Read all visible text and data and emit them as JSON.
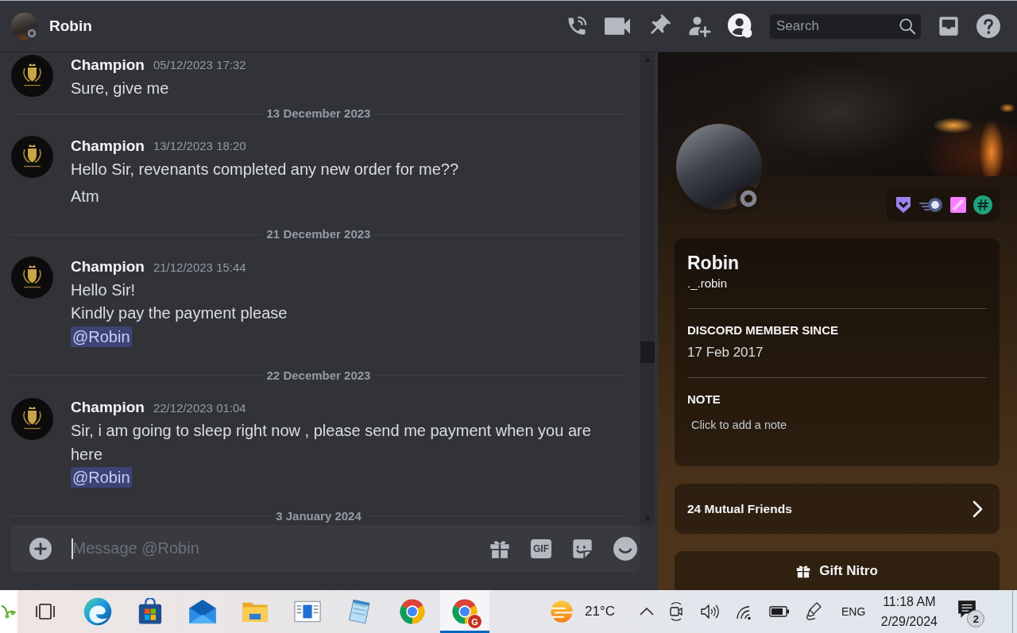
{
  "header": {
    "title": "Robin",
    "online": false,
    "profile_panel_open": true,
    "search_placeholder": "Search"
  },
  "chat": {
    "timeline": [
      {
        "kind": "group",
        "author": "Champion",
        "timestamp": "05/12/2023 17:32",
        "messages": [
          {
            "lines": [
              {
                "kind": "text",
                "text": "Sure, give me"
              }
            ]
          }
        ]
      },
      {
        "kind": "divider",
        "label": "13 December 2023"
      },
      {
        "kind": "group",
        "author": "Champion",
        "timestamp": "13/12/2023 18:20",
        "messages": [
          {
            "lines": [
              {
                "kind": "text",
                "text": "Hello Sir, revenants completed any new order for me??"
              }
            ]
          },
          {
            "lines": [
              {
                "kind": "text",
                "text": "Atm"
              }
            ]
          }
        ]
      },
      {
        "kind": "divider",
        "label": "21 December 2023"
      },
      {
        "kind": "group",
        "author": "Champion",
        "timestamp": "21/12/2023 15:44",
        "messages": [
          {
            "lines": [
              {
                "kind": "text",
                "text": "Hello Sir!"
              },
              {
                "kind": "text",
                "text": "Kindly pay the payment please"
              },
              {
                "kind": "mention",
                "text": "@Robin"
              }
            ]
          }
        ]
      },
      {
        "kind": "divider",
        "label": "22 December 2023"
      },
      {
        "kind": "group",
        "author": "Champion",
        "timestamp": "22/12/2023 01:04",
        "messages": [
          {
            "lines": [
              {
                "kind": "text",
                "text": "Sir, i am going to sleep right now , please send me payment when you are here"
              },
              {
                "kind": "mention",
                "text": "@Robin"
              }
            ]
          }
        ]
      },
      {
        "kind": "divider",
        "label": "3 January 2024"
      }
    ],
    "composer": {
      "placeholder": "Message @Robin",
      "focused": true,
      "gif_label": "GIF"
    }
  },
  "profile": {
    "display_name": "Robin",
    "username": "._.robin",
    "online": false,
    "sections": [
      {
        "heading": "DISCORD MEMBER SINCE",
        "value": "17 Feb 2017"
      }
    ],
    "note": {
      "heading": "NOTE",
      "placeholder": "Click to add a note"
    },
    "mutual_friends": "24 Mutual Friends",
    "gift_button": "Gift Nitro"
  },
  "taskbar": {
    "apps": [
      {
        "kind": "sprig",
        "selected": false
      },
      {
        "kind": "task-view",
        "selected": false
      },
      {
        "kind": "wave-browser",
        "selected": false
      },
      {
        "kind": "store",
        "selected": false
      },
      {
        "kind": "mail",
        "selected": false
      },
      {
        "kind": "folder",
        "selected": false
      },
      {
        "kind": "window",
        "selected": false
      },
      {
        "kind": "notepad",
        "selected": false
      },
      {
        "kind": "ring-browser",
        "selected": false
      },
      {
        "kind": "ring-browser",
        "selected": true,
        "badge": "G"
      }
    ],
    "weather": "21°C",
    "language": "ENG",
    "time": "11:18 AM",
    "date": "2/29/2024",
    "notification_count": "2"
  }
}
